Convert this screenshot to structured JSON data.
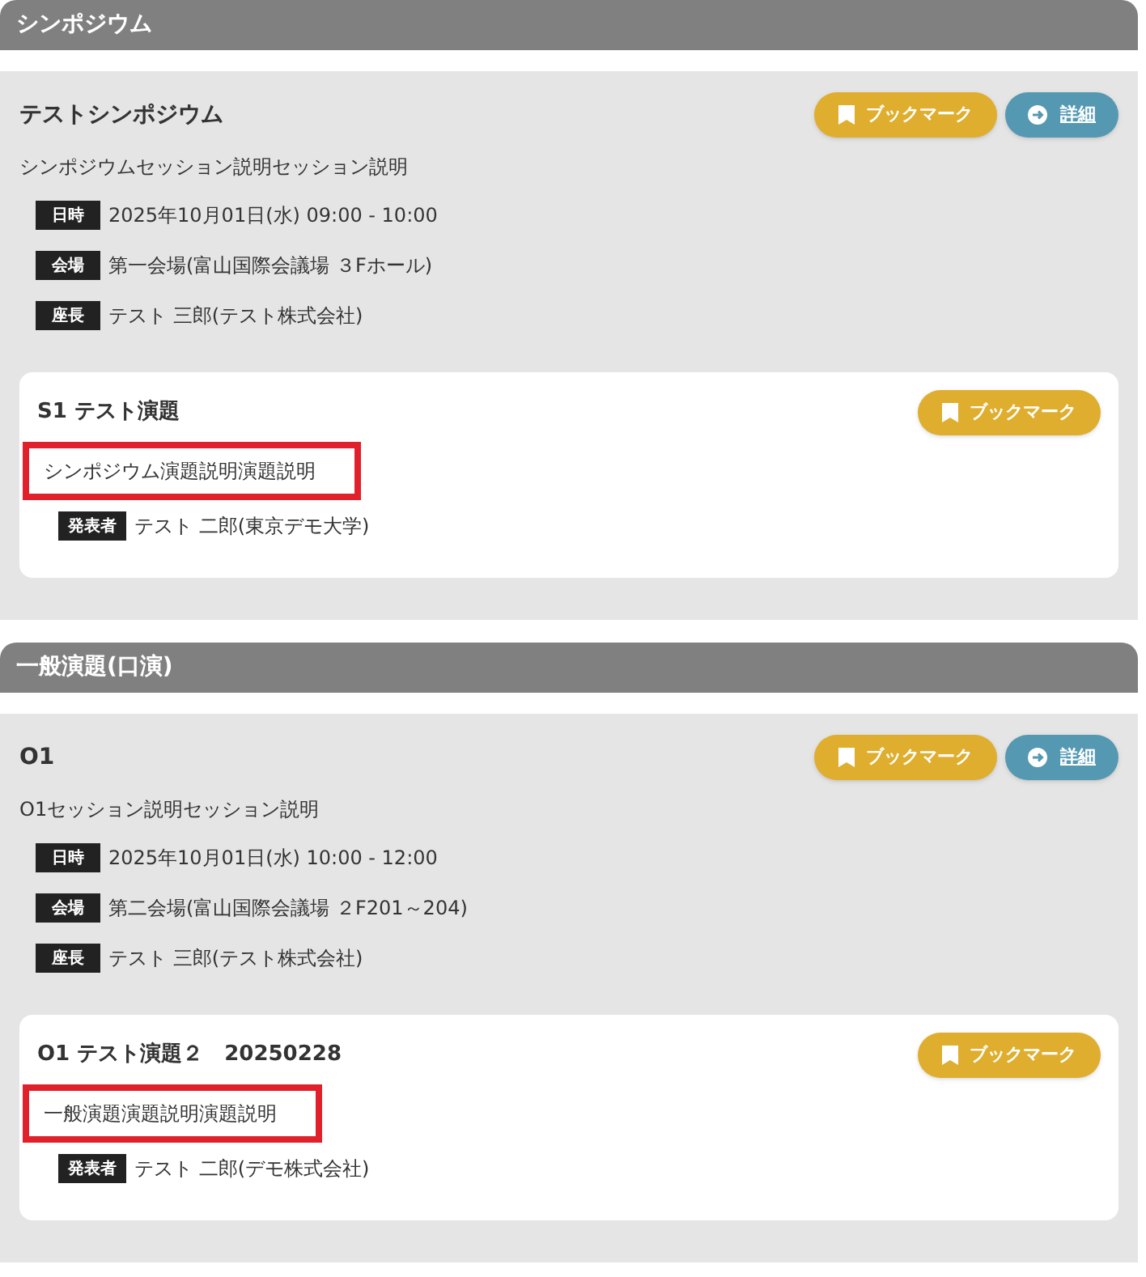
{
  "sections": [
    {
      "title": "シンポジウム",
      "sessions": [
        {
          "title": "テストシンポジウム",
          "description": "シンポジウムセッション説明セッション説明",
          "buttons": [
            {
              "kind": "bookmark",
              "label": "ブックマーク"
            },
            {
              "kind": "detail",
              "label": "詳細"
            }
          ],
          "info": [
            {
              "label": "日時",
              "value": "2025年10月01日(水) 09:00 - 10:00"
            },
            {
              "label": "会場",
              "value": "第一会場(富山国際会議場 ３Fホール)"
            },
            {
              "label": "座長",
              "value": "テスト 三郎(テスト株式会社)"
            }
          ],
          "presentations": [
            {
              "title": "S1 テスト演題",
              "description": "シンポジウム演題説明演題説明",
              "highlighted": true,
              "presenter": {
                "label": "発表者",
                "value": "テスト 二郎(東京デモ大学)"
              },
              "buttons": [
                {
                  "kind": "bookmark",
                  "label": "ブックマーク"
                }
              ]
            }
          ]
        }
      ]
    },
    {
      "title": "一般演題(口演)",
      "sessions": [
        {
          "title": "O1",
          "description": "O1セッション説明セッション説明",
          "buttons": [
            {
              "kind": "bookmark",
              "label": "ブックマーク"
            },
            {
              "kind": "detail",
              "label": "詳細"
            }
          ],
          "info": [
            {
              "label": "日時",
              "value": "2025年10月01日(水) 10:00 - 12:00"
            },
            {
              "label": "会場",
              "value": "第二会場(富山国際会議場 ２F201～204)"
            },
            {
              "label": "座長",
              "value": "テスト 三郎(テスト株式会社)"
            }
          ],
          "presentations": [
            {
              "title": "O1 テスト演題２　20250228",
              "description": "一般演題演題説明演題説明",
              "highlighted": true,
              "presenter": {
                "label": "発表者",
                "value": "テスト 二郎(デモ株式会社)"
              },
              "buttons": [
                {
                  "kind": "bookmark",
                  "label": "ブックマーク"
                }
              ]
            }
          ]
        }
      ]
    }
  ]
}
